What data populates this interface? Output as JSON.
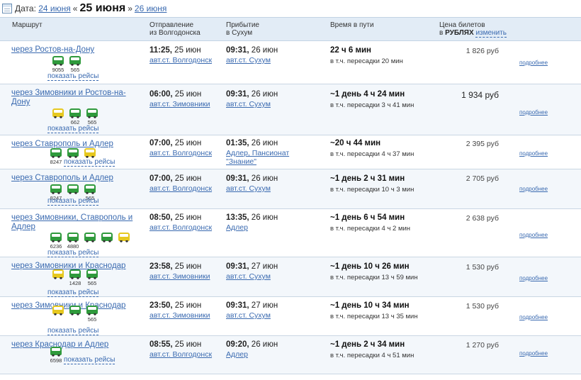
{
  "datebar": {
    "label": "Дата:",
    "prev": "24 июня",
    "sep_left": "«",
    "current": "25 июня",
    "sep_right": "»",
    "next": "26 июня"
  },
  "header": {
    "route": "Маршрут",
    "dep_1": "Отправление",
    "dep_2": "из Волгодонска",
    "arr_1": "Прибытие",
    "arr_2": "в Сухум",
    "duration": "Время в пути",
    "price_1": "Цена билетов",
    "price_in": "в",
    "price_currency": "РУБЛЯХ",
    "price_change": "изменить"
  },
  "show_flights_label": "показать рейсы",
  "details_label": "подробнее",
  "routes": [
    {
      "name": "через Ростов-на-Дону",
      "vehicles": [
        {
          "type": "bus",
          "icon": "bus-icon",
          "num": "9055"
        },
        {
          "type": "bus",
          "icon": "bus-icon",
          "num": "565"
        }
      ],
      "dep_time": "11:25,",
      "dep_date": " 25 июн",
      "dep_station": "авт.ст. Волгодонск",
      "arr_time": "09:31,",
      "arr_date": " 26 июн",
      "arr_station": "авт.ст. Сухум",
      "duration": "22 ч 6 мин",
      "transfer": "в т.ч. пересадки 20 мин",
      "price": "1 826 руб",
      "price_big": false
    },
    {
      "name": "через Зимовники и Ростов-на-Дону",
      "vehicles": [
        {
          "type": "taxi",
          "icon": "taxi-icon",
          "num": ""
        },
        {
          "type": "bus",
          "icon": "bus-icon",
          "num": "662"
        },
        {
          "type": "bus",
          "icon": "bus-icon",
          "num": "565"
        }
      ],
      "dep_time": "06:00,",
      "dep_date": " 25 июн",
      "dep_station": "авт.ст. Зимовники",
      "arr_time": "09:31,",
      "arr_date": " 26 июн",
      "arr_station": "авт.ст. Сухум",
      "duration": "~1 день 4 ч 24 мин",
      "transfer": "в т.ч. пересадки 3 ч 41 мин",
      "price": "1 934 руб",
      "price_big": true
    },
    {
      "name": "через Ставрополь и Адлер",
      "vehicles": [
        {
          "type": "bus",
          "icon": "bus-icon",
          "num": "8247"
        },
        {
          "type": "bus",
          "icon": "bus-icon",
          "num": ""
        },
        {
          "type": "taxi",
          "icon": "taxi-icon",
          "num": ""
        }
      ],
      "dep_time": "07:00,",
      "dep_date": " 25 июн",
      "dep_station": "авт.ст. Волгодонск",
      "arr_time": "01:35,",
      "arr_date": " 26 июн",
      "arr_station": "Адлер, Пансионат \"Знание\"",
      "duration": "~20 ч 44 мин",
      "transfer": "в т.ч. пересадки 4 ч 37 мин",
      "price": "2 395 руб",
      "price_big": false
    },
    {
      "name": "через Ставрополь и Адлер",
      "vehicles": [
        {
          "type": "bus",
          "icon": "bus-icon",
          "num": "8247"
        },
        {
          "type": "bus",
          "icon": "bus-icon",
          "num": ""
        },
        {
          "type": "bus",
          "icon": "bus-icon",
          "num": "565"
        }
      ],
      "dep_time": "07:00,",
      "dep_date": " 25 июн",
      "dep_station": "авт.ст. Волгодонск",
      "arr_time": "09:31,",
      "arr_date": " 26 июн",
      "arr_station": "авт.ст. Сухум",
      "duration": "~1 день 2 ч 31 мин",
      "transfer": "в т.ч. пересадки 10 ч 3 мин",
      "price": "2 705 руб",
      "price_big": false
    },
    {
      "name": "через Зимовники, Ставрополь и Адлер",
      "vehicles": [
        {
          "type": "bus",
          "icon": "bus-icon",
          "num": "6236"
        },
        {
          "type": "bus",
          "icon": "bus-icon",
          "num": "4880"
        },
        {
          "type": "bus",
          "icon": "bus-icon",
          "num": ""
        },
        {
          "type": "bus",
          "icon": "bus-icon",
          "num": ""
        },
        {
          "type": "taxi",
          "icon": "taxi-icon",
          "num": ""
        }
      ],
      "dep_time": "08:50,",
      "dep_date": " 25 июн",
      "dep_station": "авт.ст. Волгодонск",
      "arr_time": "13:35,",
      "arr_date": " 26 июн",
      "arr_station": "Адлер",
      "duration": "~1 день 6 ч 54 мин",
      "transfer": "в т.ч. пересадки 4 ч 2 мин",
      "price": "2 638 руб",
      "price_big": false
    },
    {
      "name": "через Зимовники и Краснодар",
      "vehicles": [
        {
          "type": "taxi",
          "icon": "taxi-icon",
          "num": ""
        },
        {
          "type": "bus",
          "icon": "bus-icon",
          "num": "1428"
        },
        {
          "type": "bus",
          "icon": "bus-icon",
          "num": "565"
        }
      ],
      "dep_time": "23:58,",
      "dep_date": " 25 июн",
      "dep_station": "авт.ст. Зимовники",
      "arr_time": "09:31,",
      "arr_date": " 27 июн",
      "arr_station": "авт.ст. Сухум",
      "duration": "~1 день 10 ч 26 мин",
      "transfer": "в т.ч. пересадки 13 ч 59 мин",
      "price": "1 530 руб",
      "price_big": false
    },
    {
      "name": "через Зимовники и Краснодар",
      "vehicles": [
        {
          "type": "taxi",
          "icon": "taxi-icon",
          "num": ""
        },
        {
          "type": "bus",
          "icon": "bus-icon",
          "num": ""
        },
        {
          "type": "bus",
          "icon": "bus-icon",
          "num": "565"
        }
      ],
      "dep_time": "23:50,",
      "dep_date": " 25 июн",
      "dep_station": "авт.ст. Зимовники",
      "arr_time": "09:31,",
      "arr_date": " 27 июн",
      "arr_station": "авт.ст. Сухум",
      "duration": "~1 день 10 ч 34 мин",
      "transfer": "в т.ч. пересадки 13 ч 35 мин",
      "price": "1 530 руб",
      "price_big": false
    },
    {
      "name": "через Краснодар и Адлер",
      "vehicles": [
        {
          "type": "bus",
          "icon": "bus-icon",
          "num": "6598"
        }
      ],
      "dep_time": "08:55,",
      "dep_date": " 25 июн",
      "dep_station": "авт.ст. Волгодонск",
      "arr_time": "09:20,",
      "arr_date": " 26 июн",
      "arr_station": "Адлер",
      "duration": "~1 день 2 ч 34 мин",
      "transfer": "в т.ч. пересадки 4 ч 51 мин",
      "price": "1 270 руб",
      "price_big": false
    }
  ]
}
